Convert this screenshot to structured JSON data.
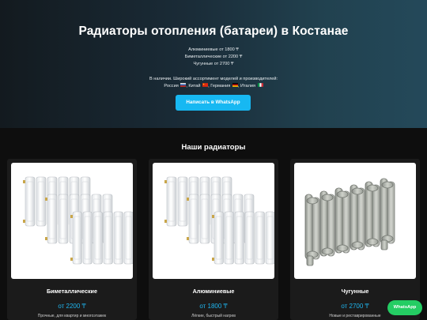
{
  "hero": {
    "title": "Радиаторы отопления (батареи) в Костанае",
    "prices": [
      "Алюминиевые от 1800 ₸",
      "Биметаллические от 2200 ₸",
      "Чугунные от 2700 ₸"
    ],
    "availability": "В наличии. Широкий ассортимент моделей и производителей:",
    "countries": [
      {
        "name": "Россия",
        "flag_icon": "russia-flag-icon"
      },
      {
        "name": "Китай",
        "flag_icon": "china-flag-icon"
      },
      {
        "name": "Германия",
        "flag_icon": "germany-flag-icon"
      },
      {
        "name": "Италия",
        "flag_icon": "italy-flag-icon"
      }
    ],
    "button": "Написать в WhatsApp"
  },
  "section": {
    "title": "Наши радиаторы"
  },
  "cards": [
    {
      "name": "Биметаллические",
      "price": "от 2200 ₸",
      "desc": "Прочные, для квартир и многоэтажек",
      "image": "white-sectional-radiator-image"
    },
    {
      "name": "Алюминиевые",
      "price": "от 1800 ₸",
      "desc": "Лёгкие, быстрый нагрев",
      "image": "white-sectional-radiator-image"
    },
    {
      "name": "Чугунные",
      "price": "от 2700 ₸",
      "desc": "Новые и реставрированные",
      "image": "cast-iron-radiator-image"
    }
  ],
  "whatsapp_float": "WhatsApp",
  "colors": {
    "accent": "#17b8f2",
    "whatsapp": "#24cd63",
    "background": "#0e0e0e",
    "card": "#1b1b1b"
  }
}
